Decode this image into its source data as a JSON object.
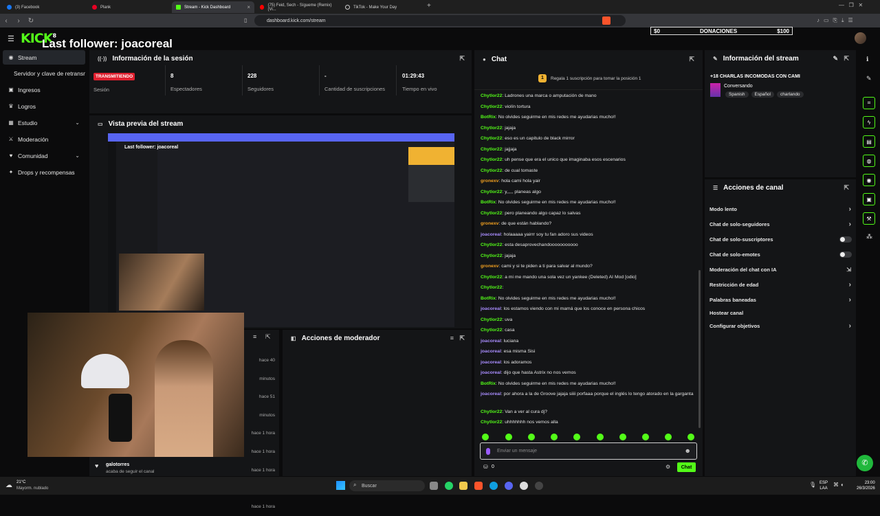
{
  "browser": {
    "tabs": [
      "(3) Facebook",
      "Plank",
      "Stream - Kick Dashboard",
      "(75) Feid, Sech - Sígueme (Remix) (Vi...",
      "TikTok - Make Your Day"
    ],
    "url": "dashboard.kick.com/stream"
  },
  "header": {
    "logo": "KICK",
    "logo_badge": "8",
    "overlay_follower": "Last follower: joacoreal",
    "donations": {
      "start": "$0",
      "label": "DONACIONES",
      "end": "$100"
    }
  },
  "sidebar": {
    "items": [
      {
        "label": "Stream",
        "icon": "broadcast-icon"
      },
      {
        "label": "Servidor y clave de retransmisión",
        "icon": ""
      },
      {
        "label": "Ingresos",
        "icon": "money-icon"
      },
      {
        "label": "Logros",
        "icon": "trophy-icon"
      },
      {
        "label": "Estudio",
        "icon": "studio-icon"
      },
      {
        "label": "Moderación",
        "icon": "sword-icon"
      },
      {
        "label": "Comunidad",
        "icon": "community-icon"
      },
      {
        "label": "Drops y recompensas",
        "icon": "gift-icon"
      }
    ]
  },
  "session": {
    "title": "Información de la sesión",
    "badge": "TRANSMITIENDO",
    "stats": [
      {
        "value": "",
        "label": "Sesión"
      },
      {
        "value": "8",
        "label": "Espectadores"
      },
      {
        "value": "228",
        "label": "Seguidores"
      },
      {
        "value": "-",
        "label": "Cantidad de suscripciones"
      },
      {
        "value": "01:29:43",
        "label": "Tiempo en vivo"
      }
    ]
  },
  "preview": {
    "title": "Vista previa del stream",
    "inner_overlay": "Last follower: joacoreal"
  },
  "activity": {
    "times": [
      "hace 40 minutos",
      "hace 51 minutos",
      "hace 1 hora",
      "hace 1 hora",
      "hace 1 hora",
      "hace 1 hora",
      "hace 1 hora"
    ],
    "last": {
      "user": "galotorres",
      "text": "acaba de seguir el canal"
    }
  },
  "mod_actions": {
    "title": "Acciones de moderador"
  },
  "chat": {
    "title": "Chat",
    "promo": "Regala 1 suscripción para tomar la posición 1",
    "messages": [
      {
        "u": "Chytlor22",
        "c": "g",
        "t": "Ladrones una marca o amputación de mano"
      },
      {
        "u": "Chytlor22",
        "c": "g",
        "t": "violín tortura"
      },
      {
        "u": "BotRix",
        "c": "g",
        "t": "No olvides seguirme en mis redes me ayudarias mucho!!"
      },
      {
        "u": "Chytlor22",
        "c": "g",
        "t": "jajaja"
      },
      {
        "u": "Chytlor22",
        "c": "g",
        "t": "eso es un capitulo de black mirror"
      },
      {
        "u": "Chytlor22",
        "c": "g",
        "t": "jajjaja"
      },
      {
        "u": "Chytlor22",
        "c": "g",
        "t": "uh pense que era el unico que imaginaba esos escenarios"
      },
      {
        "u": "Chytlor22",
        "c": "g",
        "t": "de cual tomaste"
      },
      {
        "u": "gronexv",
        "c": "o",
        "t": "hola cami hola yair"
      },
      {
        "u": "Chytlor22",
        "c": "g",
        "t": "y,,,,, planeas algo"
      },
      {
        "u": "BotRix",
        "c": "g",
        "t": "No olvides seguirme en mis redes me ayudarias mucho!!"
      },
      {
        "u": "Chytlor22",
        "c": "g",
        "t": "pero planeando algo capaz lo salvas"
      },
      {
        "u": "gronexv",
        "c": "o",
        "t": "de que están hablando?"
      },
      {
        "u": "joacoreal",
        "c": "p",
        "t": "holaaaaa yairrr soy tu fan adoro sus videos"
      },
      {
        "u": "Chytlor22",
        "c": "g",
        "t": "esta desaprovechandooooooooooo"
      },
      {
        "u": "Chytlor22",
        "c": "g",
        "t": "jajaja"
      },
      {
        "u": "gronexv",
        "c": "o",
        "t": "cami y si te piden a ti para salvar al mundo?"
      },
      {
        "u": "Chytlor22",
        "c": "g",
        "t": "a mi me mando una sola vez un yankee (Deleted)  AI Mod  [odio]"
      },
      {
        "u": "Chytlor22",
        "c": "g",
        "t": ""
      },
      {
        "u": "BotRix",
        "c": "g",
        "t": "No olvides seguirme en mis redes me ayudarias mucho!!"
      },
      {
        "u": "joacoreal",
        "c": "p",
        "t": "los estamos viendo con mi mamá que los conoce en persona chicos"
      },
      {
        "u": "Chytlor22",
        "c": "g",
        "t": "uva"
      },
      {
        "u": "Chytlor22",
        "c": "g",
        "t": "casa"
      },
      {
        "u": "joacoreal",
        "c": "p",
        "t": "luciana"
      },
      {
        "u": "joacoreal",
        "c": "p",
        "t": "esa misma Sisi"
      },
      {
        "u": "joacoreal",
        "c": "p",
        "t": "los adoramos"
      },
      {
        "u": "joacoreal",
        "c": "p",
        "t": "dijo que hasta Astrix no nos vemos"
      },
      {
        "u": "BotRix",
        "c": "g",
        "t": "No olvides seguirme en mis redes me ayudarias mucho!!"
      },
      {
        "u": "joacoreal",
        "c": "p",
        "t": "por ahora a la de Groove jajaja siiii porfaaa porque el inglés lo tengo atorado en la garganta"
      },
      {
        "u": "Chytlor22",
        "c": "g",
        "t": "Van a ver al cura dj?"
      },
      {
        "u": "Chytlor22",
        "c": "g",
        "t": "uhhhhhhh nos vemos alla"
      }
    ],
    "input_placeholder": "Enviar un mensaje",
    "points": "0",
    "send_label": "Chat"
  },
  "stream_info": {
    "title": "Información del stream",
    "stream_title": "+18 CHARLAS INCOMODAS CON CAMI",
    "category": "Conversando",
    "tags": [
      "Spanish",
      "Español",
      "charlando"
    ]
  },
  "channel_actions": {
    "title": "Acciones de canal",
    "items": [
      {
        "label": "Modo lento",
        "kind": "arrow"
      },
      {
        "label": "Chat de solo-seguidores",
        "kind": "arrow"
      },
      {
        "label": "Chat de solo-suscriptores",
        "kind": "toggle"
      },
      {
        "label": "Chat de solo-emotes",
        "kind": "toggle"
      },
      {
        "label": "Moderación del chat con IA",
        "kind": "link"
      },
      {
        "label": "Restricción de edad",
        "kind": "arrow"
      },
      {
        "label": "Palabras baneadas",
        "kind": "arrow"
      },
      {
        "label": "Hostear canal",
        "kind": "none"
      },
      {
        "label": "Configurar objetivos",
        "kind": "arrow"
      }
    ]
  },
  "taskbar": {
    "weather_temp": "21°C",
    "weather_desc": "Mayorm. nublado",
    "search": "Buscar",
    "lang": "ESP",
    "lang2": "LAA",
    "time": "23:00",
    "date": "26/3/2026"
  },
  "colors": {
    "accent": "#53fc18",
    "live": "#e0202f",
    "panel": "#141517"
  }
}
